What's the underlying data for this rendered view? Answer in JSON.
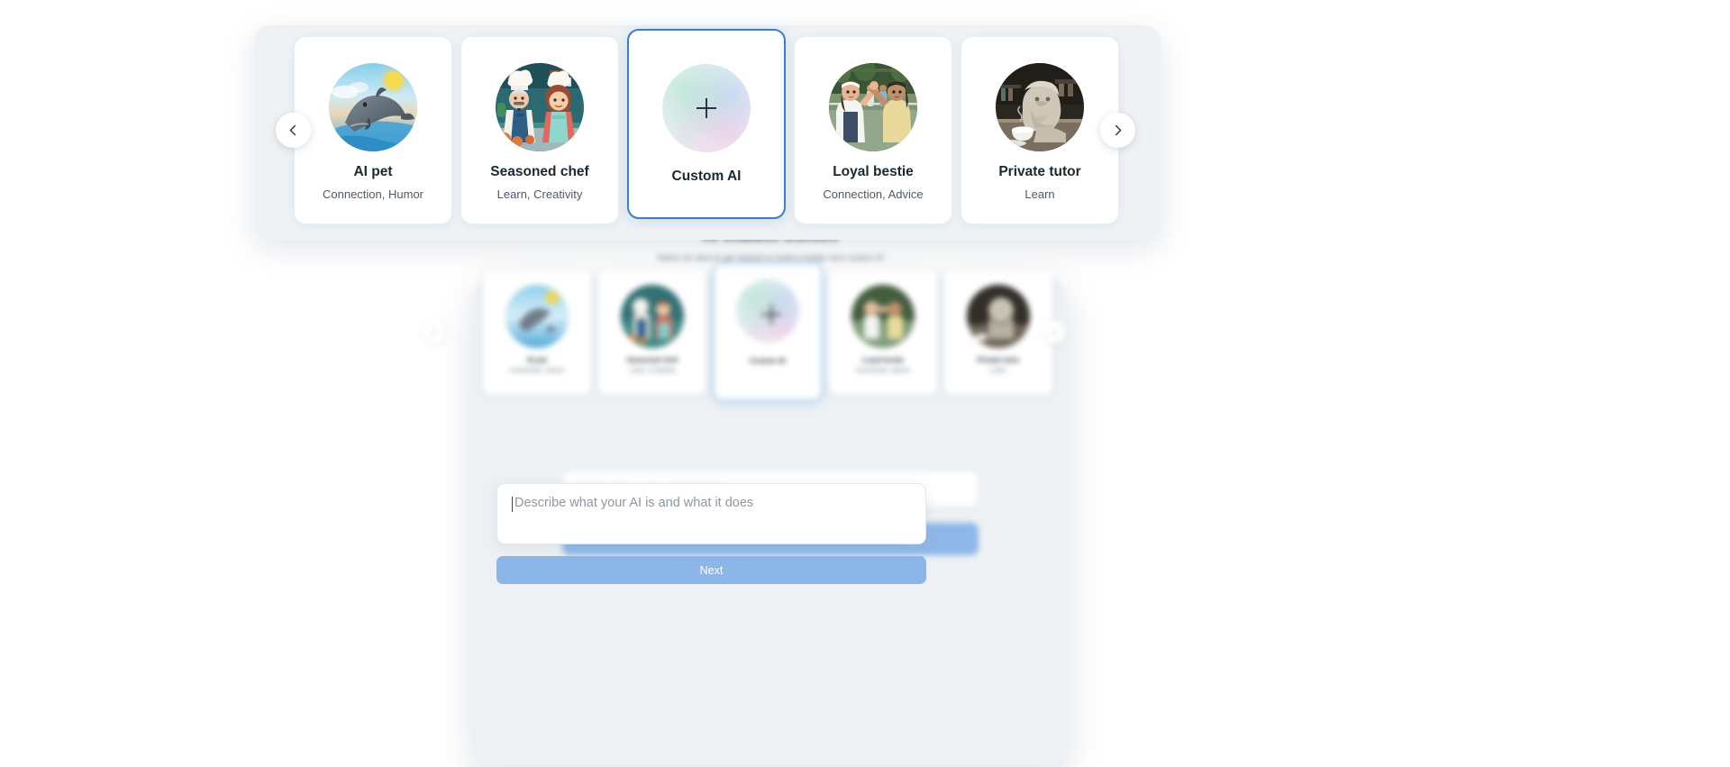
{
  "background": {
    "heading": "AI chatbot themes",
    "subheading": "Select an idea to get started or build a totally new custom AI",
    "input_placeholder": "Describe what your AI is and what it does",
    "prev_label": "‹",
    "next_label": "›"
  },
  "form": {
    "textarea_placeholder": "Describe what your AI is and what it does",
    "textarea_value": "",
    "next_label": "Next"
  },
  "carousel": {
    "prev_aria": "Previous",
    "next_aria": "Next",
    "selected_index": 2,
    "cards": [
      {
        "title": "AI pet",
        "subtitle": "Connection, Humor",
        "avatar": "dolphin",
        "selected": false
      },
      {
        "title": "Seasoned chef",
        "subtitle": "Learn, Creativity",
        "avatar": "chefs",
        "selected": false
      },
      {
        "title": "Custom AI",
        "subtitle": "",
        "avatar": "plus-orb",
        "selected": true
      },
      {
        "title": "Loyal bestie",
        "subtitle": "Connection, Advice",
        "avatar": "bestie",
        "selected": false
      },
      {
        "title": "Private tutor",
        "subtitle": "Learn",
        "avatar": "tutor",
        "selected": false
      }
    ]
  },
  "colors": {
    "accent_blue": "#3a80c7",
    "button_blue": "#8cb6e8",
    "panel_bg": "#eef2f5",
    "phone_bg": "#edf1f4",
    "text_dark": "#1c2830",
    "text_muted": "#4d5a65"
  }
}
